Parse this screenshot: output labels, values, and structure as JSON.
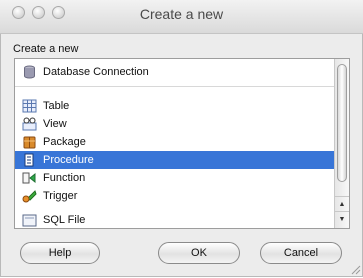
{
  "window": {
    "title": "Create a new"
  },
  "section_label": "Create a new",
  "list": {
    "items": [
      {
        "label": "Database Connection",
        "icon": "database-icon"
      },
      {
        "label": "Table",
        "icon": "table-icon"
      },
      {
        "label": "View",
        "icon": "view-icon"
      },
      {
        "label": "Package",
        "icon": "package-icon"
      },
      {
        "label": "Procedure",
        "icon": "procedure-icon"
      },
      {
        "label": "Function",
        "icon": "function-icon"
      },
      {
        "label": "Trigger",
        "icon": "trigger-icon"
      },
      {
        "label": "SQL File",
        "icon": "sql-file-icon"
      }
    ],
    "selected_index": 4
  },
  "buttons": {
    "help": "Help",
    "ok": "OK",
    "cancel": "Cancel"
  },
  "colors": {
    "selection": "#3875d7",
    "window_bg": "#ececec"
  }
}
